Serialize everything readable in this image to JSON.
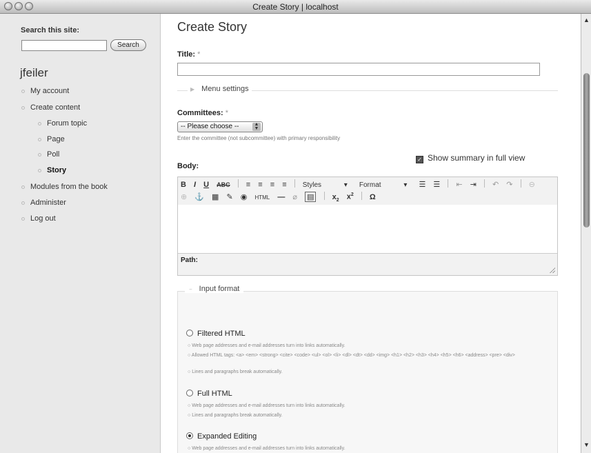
{
  "window": {
    "title": "Create Story | localhost"
  },
  "sidebar": {
    "search_label": "Search this site:",
    "search_value": "",
    "search_button": "Search",
    "username": "jfeiler",
    "nav": [
      {
        "label": "My account"
      },
      {
        "label": "Create content"
      },
      {
        "label": "Forum topic"
      },
      {
        "label": "Page"
      },
      {
        "label": "Poll"
      },
      {
        "label": "Story"
      },
      {
        "label": "Modules from the book"
      },
      {
        "label": "Administer"
      },
      {
        "label": "Log out"
      }
    ]
  },
  "main": {
    "page_title": "Create Story",
    "title_label": "Title:",
    "title_value": "",
    "required_mark": "*",
    "menu_settings": "Menu settings",
    "committees_label": "Committees:",
    "committees_selected": "-- Please choose --",
    "committees_help": "Enter the committee (not subcommittee) with primary responsibility",
    "show_summary_label": "Show summary in full view",
    "show_summary_checked": true,
    "body_label": "Body:",
    "editor": {
      "styles_label": "Styles",
      "format_label": "Format",
      "path_label": "Path:"
    },
    "input_format": {
      "legend": "Input format",
      "options": [
        {
          "label": "Filtered HTML",
          "selected": false,
          "tips": [
            "Web page addresses and e-mail addresses turn into links automatically.",
            "Allowed HTML tags: <a> <em> <strong> <cite> <code> <ul> <ol> <li> <dl> <dt> <dd> <img> <h1> <h2> <h3> <h4> <h5> <h6> <address> <pre> <div>",
            "Lines and paragraphs break automatically."
          ]
        },
        {
          "label": "Full HTML",
          "selected": false,
          "tips": [
            "Web page addresses and e-mail addresses turn into links automatically.",
            "Lines and paragraphs break automatically."
          ]
        },
        {
          "label": "Expanded Editing",
          "selected": true,
          "tips": [
            "Web page addresses and e-mail addresses turn into links automatically."
          ]
        }
      ]
    }
  }
}
